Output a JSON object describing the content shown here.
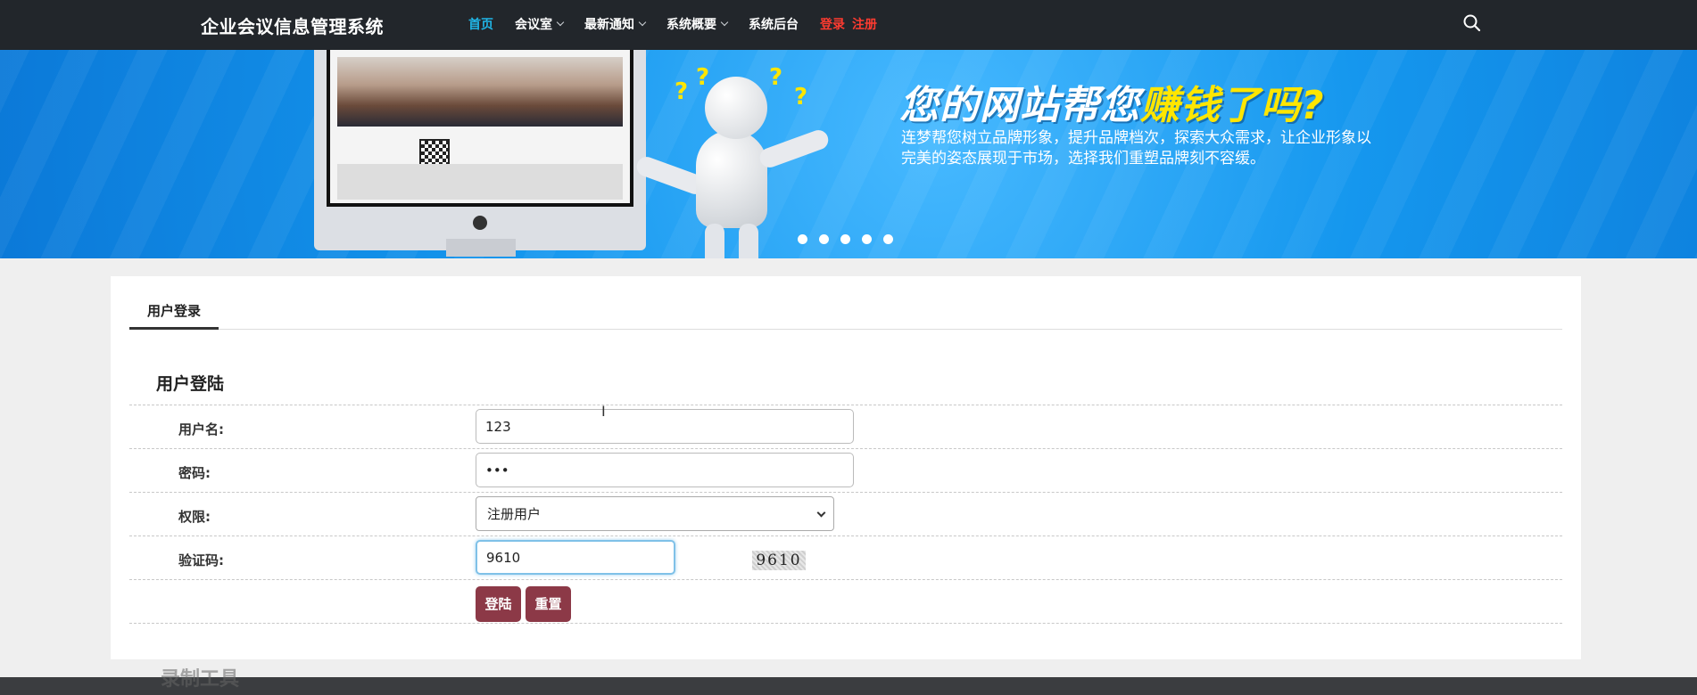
{
  "header": {
    "site_title": "企业会议信息管理系统",
    "nav": [
      {
        "label": "首页",
        "active": true
      },
      {
        "label": "会议室",
        "dropdown": true
      },
      {
        "label": "最新通知",
        "dropdown": true
      },
      {
        "label": "系统概要",
        "dropdown": true
      },
      {
        "label": "系统后台"
      }
    ],
    "login_label": "登录",
    "register_label": "注册",
    "search_icon": "search-icon"
  },
  "banner": {
    "slogan_part1": "您的网站帮您",
    "slogan_highlight": "赚钱了吗?",
    "description": "连梦帮您树立品牌形象，提升品牌档次，探索大众需求，让企业形象以完美的姿态展现于市场，选择我们重塑品牌刻不容缓。",
    "dot_count": 5
  },
  "login": {
    "tab_label": "用户登录",
    "form_title": "用户登陆",
    "username_label": "用户名:",
    "username_value": "123",
    "password_label": "密码:",
    "password_value": "•••",
    "role_label": "权限:",
    "role_value": "注册用户",
    "captcha_label": "验证码:",
    "captcha_value": "9610",
    "captcha_image_text": "9610",
    "login_button": "登陆",
    "reset_button": "重置"
  },
  "watermark": "录制工具",
  "colors": {
    "topbar": "#22262b",
    "nav_active": "#20b5e6",
    "auth_link": "#ff3b30",
    "button": "#8c3947",
    "banner": "#1597ee"
  }
}
